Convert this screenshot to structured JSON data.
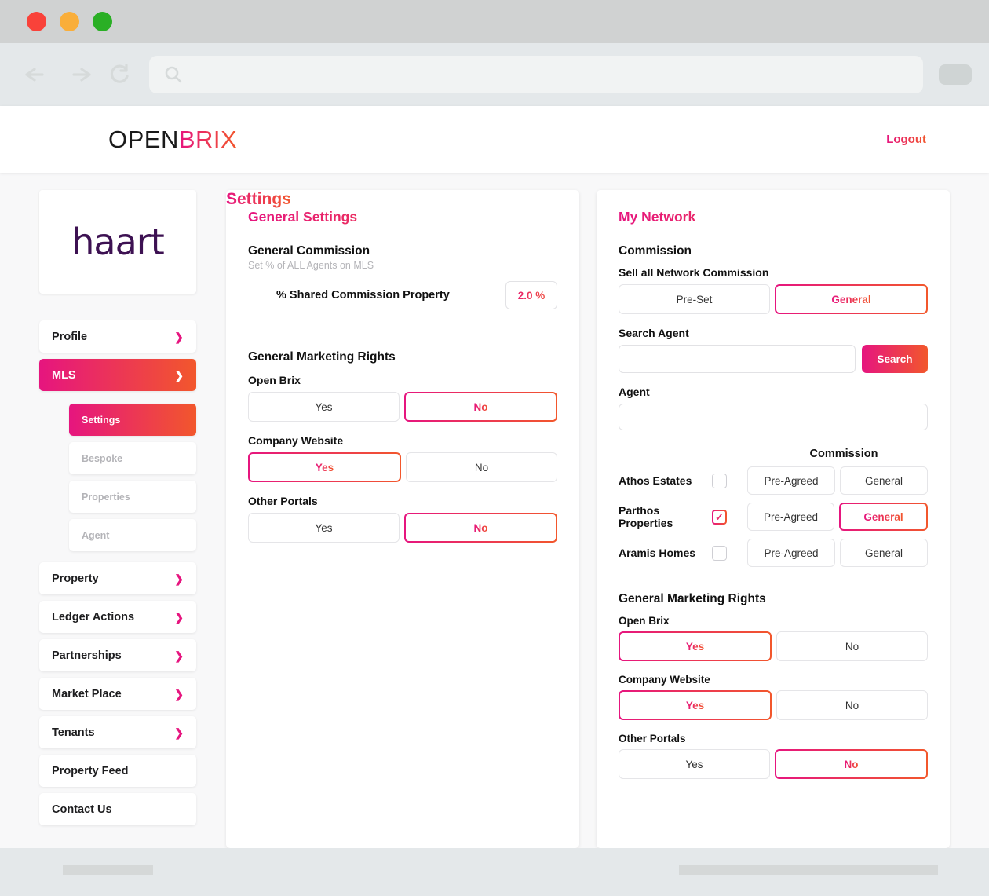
{
  "browser": {
    "traffic_lights": [
      "close",
      "minimize",
      "maximize"
    ],
    "back_icon": "back-arrow-icon",
    "forward_icon": "forward-arrow-icon",
    "reload_icon": "reload-icon",
    "search_icon": "search-icon",
    "url_value": "",
    "url_placeholder": ""
  },
  "app_header": {
    "logo_part1": "OPEN",
    "logo_part2": "BRIX",
    "logout_label": "Logout"
  },
  "sidebar": {
    "brand_logo": "haart",
    "items": [
      {
        "label": "Profile",
        "chevron": "chevron-right",
        "active": false,
        "sub": false
      },
      {
        "label": "MLS",
        "chevron": "chevron-down",
        "active": true,
        "sub": false
      },
      {
        "label": "Settings",
        "chevron": "",
        "active": true,
        "sub": true
      },
      {
        "label": "Bespoke",
        "chevron": "",
        "active": false,
        "sub": true
      },
      {
        "label": "Properties",
        "chevron": "",
        "active": false,
        "sub": true
      },
      {
        "label": "Agent",
        "chevron": "",
        "active": false,
        "sub": true
      },
      {
        "label": "Property",
        "chevron": "chevron-right",
        "active": false,
        "sub": false
      },
      {
        "label": "Ledger Actions",
        "chevron": "chevron-right",
        "active": false,
        "sub": false
      },
      {
        "label": "Partnerships",
        "chevron": "chevron-right",
        "active": false,
        "sub": false
      },
      {
        "label": "Market Place",
        "chevron": "chevron-right",
        "active": false,
        "sub": false
      },
      {
        "label": "Tenants",
        "chevron": "chevron-right",
        "active": false,
        "sub": false
      },
      {
        "label": "Property Feed",
        "chevron": "",
        "active": false,
        "sub": false
      },
      {
        "label": "Contact Us",
        "chevron": "",
        "active": false,
        "sub": false
      }
    ]
  },
  "page": {
    "title": "Settings"
  },
  "general_settings": {
    "panel_title": "General Settings",
    "commission_heading": "General Commission",
    "commission_sub": "Set % of ALL Agents on MLS",
    "commission_label": "% Shared Commission Property",
    "commission_value": "2.0 %",
    "marketing_heading": "General Marketing Rights",
    "rows": [
      {
        "label": "Open Brix",
        "yes": "Yes",
        "no": "No",
        "selected": "No"
      },
      {
        "label": "Company Website",
        "yes": "Yes",
        "no": "No",
        "selected": "Yes"
      },
      {
        "label": "Other Portals",
        "yes": "Yes",
        "no": "No",
        "selected": "No"
      }
    ]
  },
  "my_network": {
    "panel_title": "My Network",
    "commission_heading": "Commission",
    "sell_all_label": "Sell all Network Commission",
    "sell_all_options": [
      "Pre-Set",
      "General"
    ],
    "sell_all_selected": "General",
    "search_agent_label": "Search Agent",
    "search_agent_value": "",
    "search_button": "Search",
    "agent_label": "Agent",
    "agent_value": "",
    "commission_column_header": "Commission",
    "agents": [
      {
        "name": "Athos Estates",
        "checked": false,
        "options": [
          "Pre-Agreed",
          "General"
        ],
        "selected": ""
      },
      {
        "name": "Parthos Properties",
        "checked": true,
        "options": [
          "Pre-Agreed",
          "General"
        ],
        "selected": "General"
      },
      {
        "name": "Aramis Homes",
        "checked": false,
        "options": [
          "Pre-Agreed",
          "General"
        ],
        "selected": ""
      }
    ],
    "marketing_heading": "General Marketing Rights",
    "rows": [
      {
        "label": "Open Brix",
        "yes": "Yes",
        "no": "No",
        "selected": "Yes"
      },
      {
        "label": "Company Website",
        "yes": "Yes",
        "no": "No",
        "selected": "Yes"
      },
      {
        "label": "Other Portals",
        "yes": "Yes",
        "no": "No",
        "selected": "No"
      }
    ]
  },
  "colors": {
    "accent_pink": "#e6157f",
    "accent_orange": "#f2572c",
    "brand_purple": "#3d1152",
    "page_bg": "#f8f8f9",
    "chrome_bg": "#e4e8ea"
  }
}
